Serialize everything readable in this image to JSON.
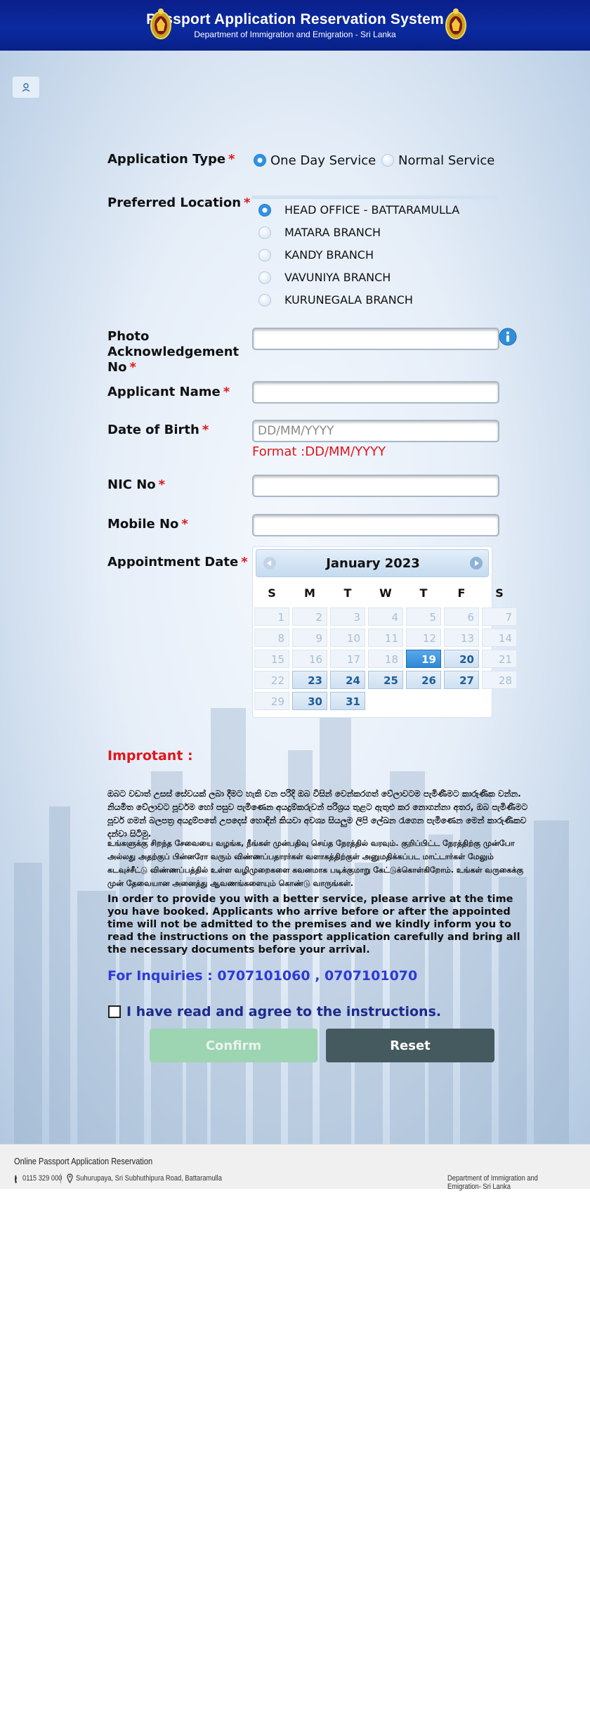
{
  "header": {
    "title": "Passport Application Reservation System",
    "subtitle": "Department of Immigration and Emigration - Sri Lanka"
  },
  "form": {
    "application_type": {
      "label": "Application Type",
      "options": [
        "One Day Service",
        "Normal Service"
      ],
      "selected": "One Day Service"
    },
    "preferred_location": {
      "label": "Preferred Location",
      "options": [
        "HEAD OFFICE - BATTARAMULLA",
        "MATARA BRANCH",
        "KANDY BRANCH",
        "VAVUNIYA BRANCH",
        "KURUNEGALA BRANCH"
      ],
      "selected": "HEAD OFFICE - BATTARAMULLA"
    },
    "photo_ack": {
      "label": "Photo Acknowledgement No",
      "value": ""
    },
    "applicant_name": {
      "label": "Applicant Name",
      "value": ""
    },
    "dob": {
      "label": "Date of Birth",
      "placeholder": "DD/MM/YYYY",
      "format_note": "Format :DD/MM/YYYY"
    },
    "nic": {
      "label": "NIC No",
      "value": ""
    },
    "mobile": {
      "label": "Mobile No",
      "value": ""
    },
    "appointment_date": {
      "label": "Appointment Date"
    },
    "required_mark": "*"
  },
  "calendar": {
    "title": "January 2023",
    "weekdays": [
      "S",
      "M",
      "T",
      "W",
      "T",
      "F",
      "S"
    ],
    "today": 19,
    "available": [
      20,
      23,
      24,
      25,
      26,
      27,
      30,
      31
    ],
    "weeks": [
      [
        1,
        2,
        3,
        4,
        5,
        6,
        7
      ],
      [
        8,
        9,
        10,
        11,
        12,
        13,
        14
      ],
      [
        15,
        16,
        17,
        18,
        19,
        20,
        21
      ],
      [
        22,
        23,
        24,
        25,
        26,
        27,
        28
      ],
      [
        29,
        30,
        31
      ]
    ]
  },
  "notice": {
    "heading": "Improtant :",
    "sinhala": "ඔබට වඩාත් උසස් සේවයක් ලබා දීමට හැකි වන පරිදි ඔබ විසින් වෙන්කරගත් වේලාවටම පැමිණීමට කාරුණික වන්න. නියමිත වේලාවට පූර්වම හෝ පසුව පැමිණෙන අයදුම්කරුවන් පරිශ්‍රය තුළට ඇතුළු කර නොගන්නා අතර, ඔබ පැමිණීමට පූර්ව ගමන් බලපත්‍ර අයදුම්පතේ උපදෙස් හොඳින් කියවා අවශ්‍ය සියලුම ලිපි ලේඛන රැගෙන පැමිණෙන මෙන් කාරුණිකව දන්වා සිටිමු.",
    "tamil": "உங்களுக்கு சிறந்த சேவையை வழங்க, நீங்கள் முன்பதிவு செய்த நேரத்தில் வரவும். குறிப்பிட்ட நேரத்திற்கு முன்போ அல்லது அதற்குப் பின்னரோ வரும் விண்ணப்பதாரர்கள் வளாகத்திற்குள் அனுமதிக்கப்பட மாட்டார்கள் மேலும் கடவுச்சீட்டு விண்ணப்பத்தில் உள்ள வழிமுறைகளை கவனமாக படிக்குமாறு கேட்டுக்கொள்கிறோம். உங்கள் வருகைக்கு முன் தேவையான அனைத்து ஆவணங்களையும் கொண்டு வாருங்கள்.",
    "english": "In order to provide you with a better service, please arrive at the time you have booked. Applicants who arrive before or after the appointed time will not be admitted to the premises and we kindly inform you to read the instructions on the passport application carefully and bring all the necessary documents before your arrival.",
    "inquiries": "For Inquiries : 0707101060 , 0707101070"
  },
  "agreement": {
    "label": "I have read and agree to the instructions.",
    "checked": false
  },
  "buttons": {
    "confirm": "Confirm",
    "reset": "Reset"
  },
  "footer": {
    "title": "Online Passport Application Reservation",
    "phone": "0115 329 000",
    "address": "Suhurupaya, Sri Subhuthipura Road, Battaramulla",
    "department": "Department of Immigration and Emigration- Sri Lanka"
  },
  "colors": {
    "header_bg": "#0b2aa0",
    "required": "#e0151b",
    "inquiry": "#2d3ad6",
    "confirm_bg": "#9dd4b2",
    "reset_bg": "#455a5e",
    "calendar_today": "#2f88d6"
  },
  "icons": {
    "emblem": "sri-lanka-emblem-icon",
    "login": "user-icon",
    "info": "info-icon",
    "phone": "phone-icon",
    "location": "map-pin-icon"
  }
}
